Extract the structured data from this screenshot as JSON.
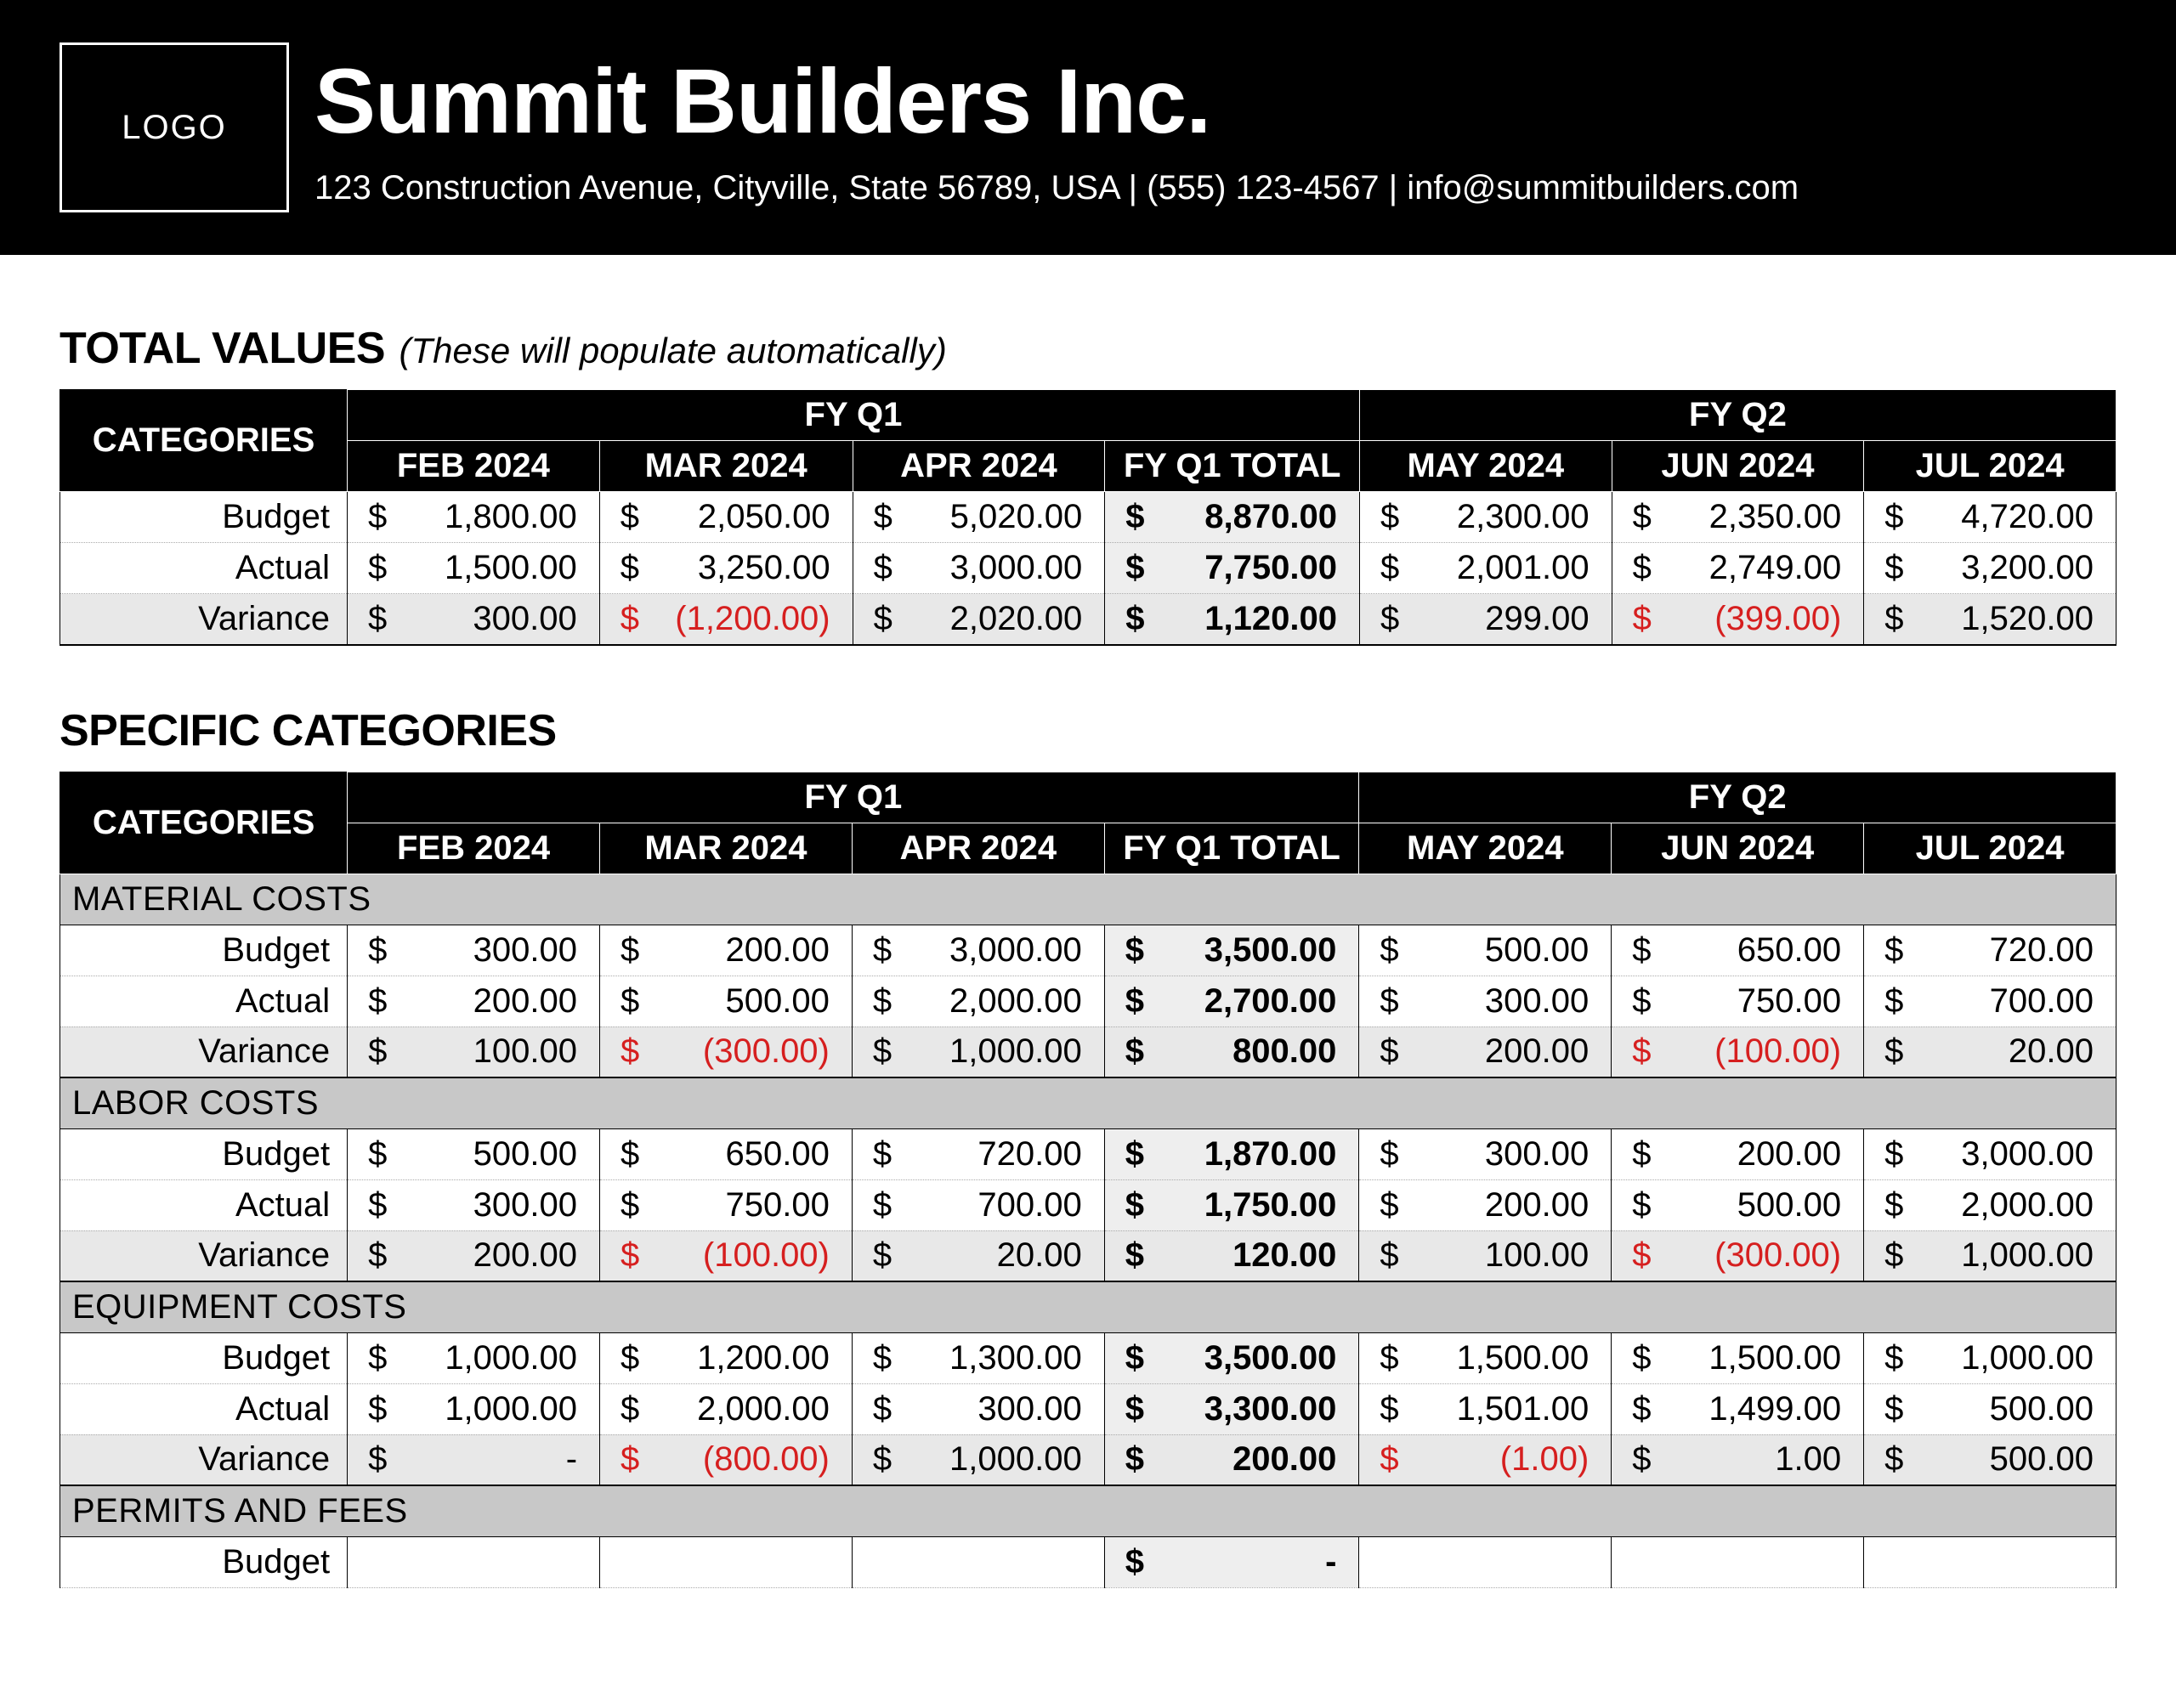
{
  "header": {
    "logo_text": "LOGO",
    "company": "Summit Builders Inc.",
    "contact": "123 Construction Avenue, Cityville, State 56789, USA | (555) 123-4567 | info@summitbuilders.com"
  },
  "totals": {
    "title": "TOTAL VALUES",
    "note": "(These will populate automatically)",
    "cat_header": "CATEGORIES",
    "q1_header": "FY Q1",
    "q2_header": "FY Q2",
    "months": [
      "FEB 2024",
      "MAR 2024",
      "APR 2024",
      "FY Q1 TOTAL",
      "MAY 2024",
      "JUN 2024",
      "JUL 2024"
    ],
    "rows": {
      "budget": {
        "label": "Budget",
        "vals": [
          "1,800.00",
          "2,050.00",
          "5,020.00",
          "8,870.00",
          "2,300.00",
          "2,350.00",
          "4,720.00"
        ]
      },
      "actual": {
        "label": "Actual",
        "vals": [
          "1,500.00",
          "3,250.00",
          "3,000.00",
          "7,750.00",
          "2,001.00",
          "2,749.00",
          "3,200.00"
        ]
      },
      "variance": {
        "label": "Variance",
        "vals": [
          "300.00",
          "(1,200.00)",
          "2,020.00",
          "1,120.00",
          "299.00",
          "(399.00)",
          "1,520.00"
        ],
        "neg": [
          false,
          true,
          false,
          false,
          false,
          true,
          false
        ]
      }
    }
  },
  "specific": {
    "title": "SPECIFIC CATEGORIES",
    "cat_header": "CATEGORIES",
    "q1_header": "FY Q1",
    "q2_header": "FY Q2",
    "months": [
      "FEB 2024",
      "MAR 2024",
      "APR 2024",
      "FY Q1 TOTAL",
      "MAY 2024",
      "JUN 2024",
      "JUL 2024"
    ],
    "groups": [
      {
        "name": "MATERIAL COSTS",
        "budget": [
          "300.00",
          "200.00",
          "3,000.00",
          "3,500.00",
          "500.00",
          "650.00",
          "720.00"
        ],
        "actual": [
          "200.00",
          "500.00",
          "2,000.00",
          "2,700.00",
          "300.00",
          "750.00",
          "700.00"
        ],
        "variance": [
          "100.00",
          "(300.00)",
          "1,000.00",
          "800.00",
          "200.00",
          "(100.00)",
          "20.00"
        ],
        "neg": [
          false,
          true,
          false,
          false,
          false,
          true,
          false
        ]
      },
      {
        "name": "LABOR COSTS",
        "budget": [
          "500.00",
          "650.00",
          "720.00",
          "1,870.00",
          "300.00",
          "200.00",
          "3,000.00"
        ],
        "actual": [
          "300.00",
          "750.00",
          "700.00",
          "1,750.00",
          "200.00",
          "500.00",
          "2,000.00"
        ],
        "variance": [
          "200.00",
          "(100.00)",
          "20.00",
          "120.00",
          "100.00",
          "(300.00)",
          "1,000.00"
        ],
        "neg": [
          false,
          true,
          false,
          false,
          false,
          true,
          false
        ]
      },
      {
        "name": "EQUIPMENT COSTS",
        "budget": [
          "1,000.00",
          "1,200.00",
          "1,300.00",
          "3,500.00",
          "1,500.00",
          "1,500.00",
          "1,000.00"
        ],
        "actual": [
          "1,000.00",
          "2,000.00",
          "300.00",
          "3,300.00",
          "1,501.00",
          "1,499.00",
          "500.00"
        ],
        "variance": [
          "-",
          "(800.00)",
          "1,000.00",
          "200.00",
          "(1.00)",
          "1.00",
          "500.00"
        ],
        "neg": [
          false,
          true,
          false,
          false,
          true,
          false,
          false
        ]
      },
      {
        "name": "PERMITS AND FEES",
        "budget": [
          "",
          "",
          "",
          "-",
          "",
          "",
          ""
        ],
        "actual": null,
        "variance": null
      }
    ],
    "row_labels": {
      "budget": "Budget",
      "actual": "Actual",
      "variance": "Variance"
    }
  }
}
